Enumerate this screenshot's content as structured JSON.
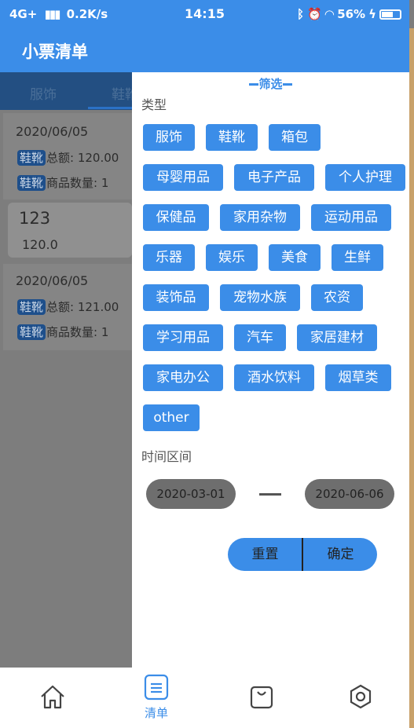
{
  "status_bar": {
    "network": "4G+",
    "speed": "0.2K/s",
    "time": "14:15",
    "battery": "56%"
  },
  "header": {
    "title": "小票清单"
  },
  "tabs": [
    "服饰",
    "鞋靴"
  ],
  "background_list": [
    {
      "date": "2020/06/05",
      "lines": [
        {
          "tag": "鞋靴",
          "text": "总额: 120.00"
        },
        {
          "tag": "鞋靴",
          "text": "商品数量: 1"
        }
      ]
    },
    {
      "date": "2020/06/05",
      "lines": [
        {
          "tag": "鞋靴",
          "text": "总额: 121.00"
        },
        {
          "tag": "鞋靴",
          "text": "商品数量: 1"
        }
      ]
    }
  ],
  "mini_card": {
    "name": "123",
    "amount": "120.0"
  },
  "filter": {
    "title": "筛选",
    "type_label": "类型",
    "categories": [
      "服饰",
      "鞋靴",
      "箱包",
      "母婴用品",
      "电子产品",
      "个人护理",
      "保健品",
      "家用杂物",
      "运动用品",
      "乐器",
      "娱乐",
      "美食",
      "生鲜",
      "装饰品",
      "宠物水族",
      "农资",
      "学习用品",
      "汽车",
      "家居建材",
      "家电办公",
      "酒水饮料",
      "烟草类",
      "other"
    ],
    "time_label": "时间区间",
    "date_start": "2020-03-01",
    "date_end": "2020-06-06",
    "reset_label": "重置",
    "confirm_label": "确定"
  },
  "bottom_nav": {
    "items": [
      {
        "icon": "home-icon",
        "label": ""
      },
      {
        "icon": "list-icon",
        "label": "清单"
      },
      {
        "icon": "bag-icon",
        "label": ""
      },
      {
        "icon": "settings-icon",
        "label": ""
      }
    ]
  },
  "colors": {
    "accent": "#3b8de8",
    "overlay": "#7d7d7d"
  }
}
